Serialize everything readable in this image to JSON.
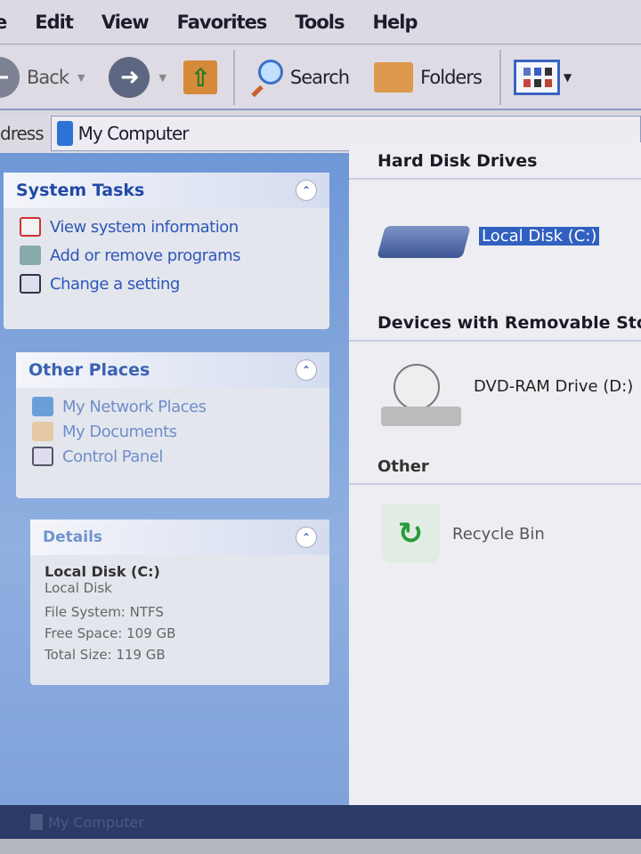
{
  "menu": [
    "e",
    "Edit",
    "View",
    "Favorites",
    "Tools",
    "Help"
  ],
  "toolbar": {
    "back": "Back",
    "search": "Search",
    "folders": "Folders"
  },
  "address": {
    "label": "dress",
    "value": "My Computer"
  },
  "system_tasks": {
    "title": "System Tasks",
    "items": [
      "View system information",
      "Add or remove programs",
      "Change a setting"
    ]
  },
  "other_places": {
    "title": "Other Places",
    "items": [
      "My Network Places",
      "My Documents",
      "Control Panel"
    ]
  },
  "details": {
    "title": "Details",
    "name": "Local Disk (C:)",
    "type": "Local Disk",
    "file_system": "File System: NTFS",
    "free_space": "Free Space: 109 GB",
    "total_size": "Total Size: 119 GB"
  },
  "content": {
    "hdd_header": "Hard Disk Drives",
    "local_disk": "Local Disk (C:)",
    "removable_header": "Devices with Removable Storage",
    "dvd": "DVD-RAM Drive (D:)",
    "other_header": "Other",
    "recycle": "Recycle Bin"
  },
  "status": {
    "text": "My Computer"
  }
}
